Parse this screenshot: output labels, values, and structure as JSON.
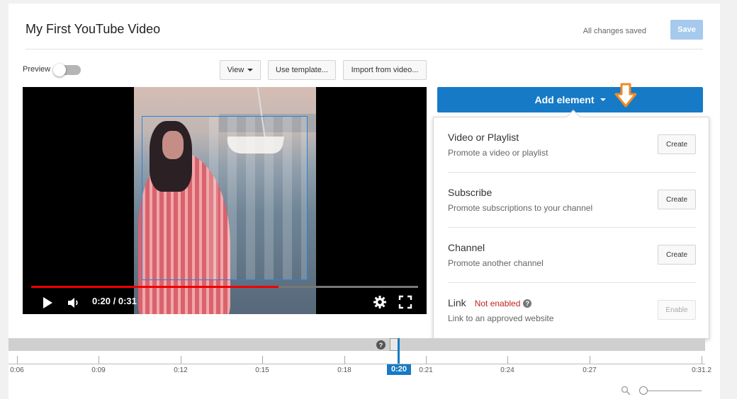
{
  "header": {
    "title": "My First YouTube Video",
    "status": "All changes saved",
    "save_label": "Save"
  },
  "toolbar": {
    "preview_label": "Preview",
    "preview_on": false,
    "view_label": "View",
    "template_label": "Use template...",
    "import_label": "Import from video..."
  },
  "player": {
    "current_time": "0:20 / 0:31",
    "progress_fraction": 0.64,
    "buffer_fraction": 0.64
  },
  "editor": {
    "add_element_label": "Add element",
    "items": [
      {
        "title": "Video or Playlist",
        "desc": "Promote a video or playlist",
        "button": "Create"
      },
      {
        "title": "Subscribe",
        "desc": "Promote subscriptions to your channel",
        "button": "Create"
      },
      {
        "title": "Channel",
        "desc": "Promote another channel",
        "button": "Create"
      },
      {
        "title": "Link",
        "status": "Not enabled",
        "desc": "Link to an approved website",
        "button": "Enable"
      }
    ]
  },
  "timeline": {
    "current_marker": "0:20",
    "help_symbol": "?",
    "ticks": [
      "0:06",
      "0:09",
      "0:12",
      "0:15",
      "0:18",
      "0:21",
      "0:24",
      "0:27",
      "0:31.2"
    ]
  },
  "colors": {
    "accent": "#167ac6",
    "progress_red": "#ee0000",
    "warning_red": "#c32222",
    "callout_orange": "#f08a24"
  }
}
